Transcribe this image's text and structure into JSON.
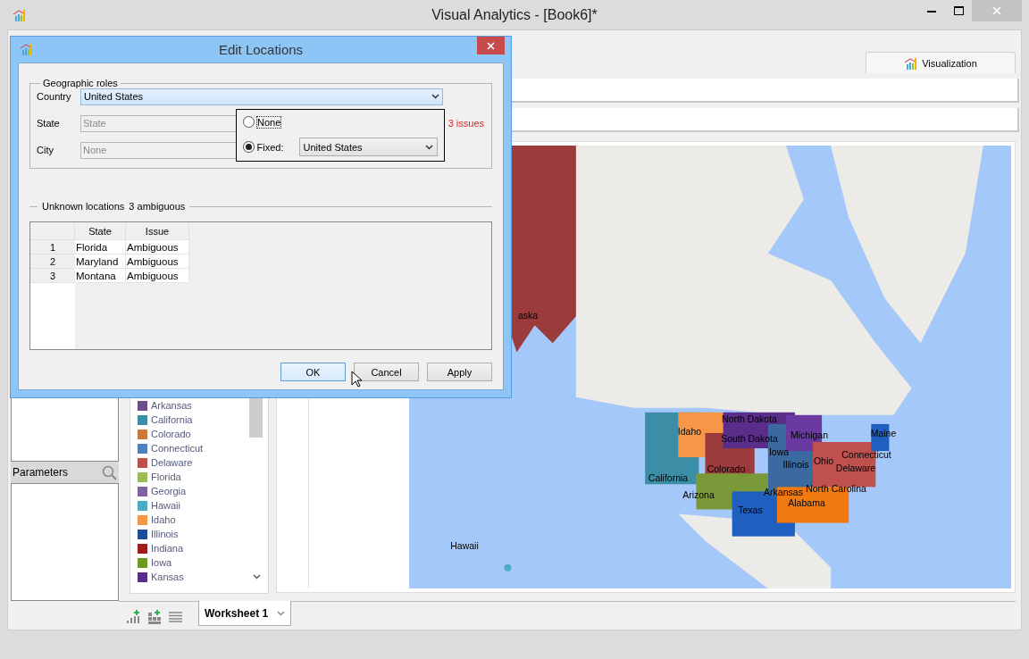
{
  "window": {
    "title": "Visual Analytics - [Book6]*"
  },
  "tabs": [
    {
      "label": "Visualization",
      "selected": true
    }
  ],
  "parameters": {
    "title": "Parameters"
  },
  "legend": {
    "items": [
      {
        "label": "Arkansas",
        "color": "#6a4f8a"
      },
      {
        "label": "California",
        "color": "#3b8ea5"
      },
      {
        "label": "Colorado",
        "color": "#cc7a3a"
      },
      {
        "label": "Connecticut",
        "color": "#4f81bd"
      },
      {
        "label": "Delaware",
        "color": "#c0504d"
      },
      {
        "label": "Florida",
        "color": "#9bbb59"
      },
      {
        "label": "Georgia",
        "color": "#8064a2"
      },
      {
        "label": "Hawaii",
        "color": "#4bacc6"
      },
      {
        "label": "Idaho",
        "color": "#f79646"
      },
      {
        "label": "Illinois",
        "color": "#1f4e99"
      },
      {
        "label": "Indiana",
        "color": "#a01c1c"
      },
      {
        "label": "Iowa",
        "color": "#6b9a1f"
      },
      {
        "label": "Kansas",
        "color": "#5a2d8a"
      }
    ]
  },
  "map": {
    "labels": [
      "aska",
      "North Dakota",
      "Idaho",
      "South Dakota",
      "Michigan",
      "Maine",
      "Iowa",
      "Connecticut",
      "Illinois",
      "Ohio",
      "Delaware",
      "California",
      "Colorado",
      "Arkansas",
      "North Carolina",
      "Arizona",
      "Alabama",
      "Texas",
      "Hawaii"
    ]
  },
  "worksheets": [
    {
      "label": "Worksheet 1",
      "selected": true
    }
  ],
  "dialog": {
    "title": "Edit Locations",
    "geographic_roles": {
      "title": "Geographic roles",
      "issues": "3 issues",
      "fields": [
        {
          "label": "Country",
          "kind": "combo",
          "value": "United States"
        },
        {
          "label": "State",
          "kind": "text",
          "placeholder": "State"
        },
        {
          "label": "City",
          "kind": "text",
          "placeholder": "None"
        }
      ]
    },
    "popup": {
      "options": [
        {
          "label": "None",
          "selected": false
        },
        {
          "label": "Fixed:",
          "selected": true,
          "value": "United States"
        }
      ]
    },
    "unknown": {
      "title": "Unknown locations",
      "summary": "3 ambiguous",
      "columns": [
        "State",
        "Issue"
      ],
      "rows": [
        {
          "number": "1",
          "state": "Florida",
          "issue": "Ambiguous"
        },
        {
          "number": "2",
          "state": "Maryland",
          "issue": "Ambiguous"
        },
        {
          "number": "3",
          "state": "Montana",
          "issue": "Ambiguous"
        }
      ]
    },
    "buttons": [
      {
        "label": "OK",
        "default": true
      },
      {
        "label": "Cancel",
        "default": false
      },
      {
        "label": "Apply",
        "default": false
      }
    ]
  }
}
